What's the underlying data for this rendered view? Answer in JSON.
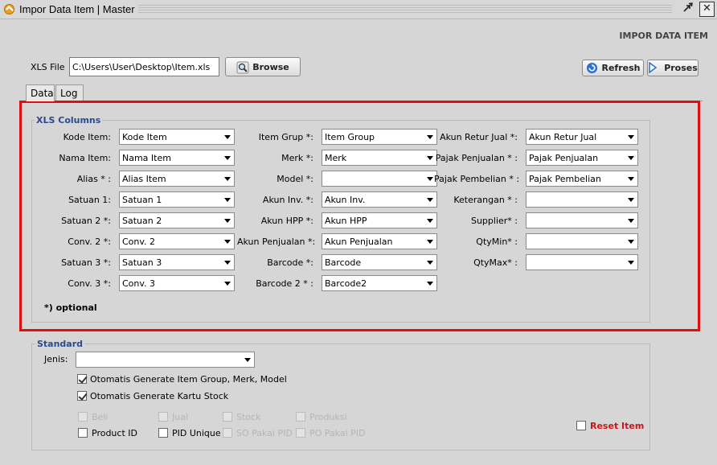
{
  "window": {
    "title": "Impor Data Item | Master",
    "restore_icon": "restore-icon",
    "close_glyph": "✕"
  },
  "header": {
    "label": "IMPOR DATA ITEM"
  },
  "file": {
    "label": "XLS File",
    "value": "C:\\Users\\User\\Desktop\\Item.xls"
  },
  "buttons": {
    "browse": "Browse",
    "refresh": "Refresh",
    "proses": "Proses"
  },
  "tabs": [
    {
      "label": "Data"
    },
    {
      "label": "Log"
    }
  ],
  "xls_columns": {
    "title": "XLS Columns",
    "col1": [
      {
        "label": "Kode Item:",
        "value": "Kode Item"
      },
      {
        "label": "Nama Item:",
        "value": "Nama Item"
      },
      {
        "label": "Alias * :",
        "value": "Alias Item"
      },
      {
        "label": "Satuan 1:",
        "value": "Satuan 1"
      },
      {
        "label": "Satuan 2 *:",
        "value": "Satuan 2"
      },
      {
        "label": "Conv. 2 *:",
        "value": "Conv. 2"
      },
      {
        "label": "Satuan 3 *:",
        "value": "Satuan 3"
      },
      {
        "label": "Conv. 3 *:",
        "value": "Conv. 3"
      }
    ],
    "col2": [
      {
        "label": "Item Grup *:",
        "value": "Item Group"
      },
      {
        "label": "Merk *:",
        "value": "Merk"
      },
      {
        "label": "Model *:",
        "value": ""
      },
      {
        "label": "Akun Inv. *:",
        "value": "Akun Inv."
      },
      {
        "label": "Akun HPP *:",
        "value": "Akun HPP"
      },
      {
        "label": "Akun Penjualan *:",
        "value": "Akun Penjualan"
      },
      {
        "label": "Barcode *:",
        "value": "Barcode"
      },
      {
        "label": "Barcode 2 * :",
        "value": "Barcode2"
      }
    ],
    "col3": [
      {
        "label": "Akun Retur Jual *:",
        "value": "Akun Retur Jual"
      },
      {
        "label": "Pajak Penjualan * :",
        "value": "Pajak Penjualan"
      },
      {
        "label": "Pajak Pembelian * :",
        "value": "Pajak Pembelian"
      },
      {
        "label": "Keterangan * :",
        "value": ""
      },
      {
        "label": "Supplier* :",
        "value": ""
      },
      {
        "label": "QtyMin* :",
        "value": ""
      },
      {
        "label": "QtyMax* :",
        "value": ""
      }
    ],
    "optional_note": "*) optional"
  },
  "standard": {
    "title": "Standard",
    "jenis_label": "Jenis:",
    "jenis_value": "",
    "auto_group": {
      "label": "Otomatis Generate Item Group, Merk, Model",
      "checked": true
    },
    "auto_kartu": {
      "label": "Otomatis Generate Kartu Stock",
      "checked": true
    },
    "options_row1": [
      {
        "label": "Beli",
        "checked": false,
        "enabled": false
      },
      {
        "label": "Jual",
        "checked": false,
        "enabled": false
      },
      {
        "label": "Stock",
        "checked": false,
        "enabled": false
      },
      {
        "label": "Produksi",
        "checked": false,
        "enabled": false
      }
    ],
    "options_row2": [
      {
        "label": "Product ID",
        "checked": false,
        "enabled": true
      },
      {
        "label": "PID Unique",
        "checked": false,
        "enabled": true
      },
      {
        "label": "SO Pakai PID",
        "checked": false,
        "enabled": false
      },
      {
        "label": "PO Pakai PID",
        "checked": false,
        "enabled": false
      }
    ],
    "reset_item": {
      "label": "Reset Item",
      "checked": false
    }
  },
  "colors": {
    "frame_highlight": "#e01010",
    "group_title": "#2b4a8f",
    "reset_label": "#c8161d"
  }
}
